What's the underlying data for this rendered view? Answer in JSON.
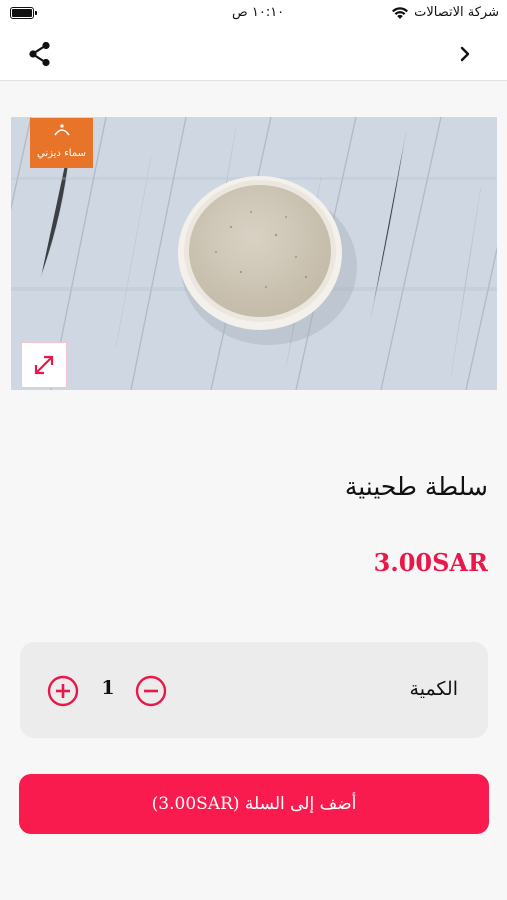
{
  "status_bar": {
    "time": "١٠:١٠ ص",
    "carrier": "شركة الاتصالات"
  },
  "nav": {
    "share_icon": "share-icon",
    "back_icon": "chevron-right-icon"
  },
  "product": {
    "logo_text": "سماء ديزني",
    "name": "سلطة طحينية",
    "price": "3.00SAR",
    "expand_icon": "expand-icon"
  },
  "quantity": {
    "label": "الكمية",
    "value": "1",
    "plus_icon": "plus-circle-icon",
    "minus_icon": "minus-circle-icon"
  },
  "cart": {
    "add_label": "أضف إلى السلة (3.00SAR)"
  },
  "colors": {
    "accent": "#fa1b4e",
    "price": "#e8194a",
    "logo_bg": "#e8742a"
  }
}
